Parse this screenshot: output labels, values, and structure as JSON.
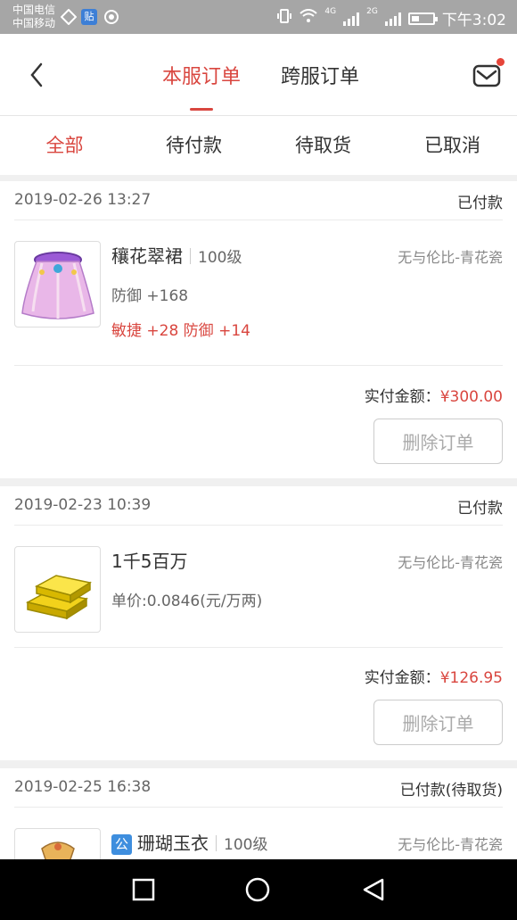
{
  "status_bar": {
    "carrier1": "中国电信",
    "carrier2": "中国移动",
    "tieba_badge": "贴",
    "net1": "4G",
    "net2": "2G",
    "time": "下午3:02"
  },
  "header": {
    "tabs": [
      {
        "label": "本服订单",
        "active": true
      },
      {
        "label": "跨服订单",
        "active": false
      }
    ],
    "accent": "#d9463f"
  },
  "filters": [
    {
      "label": "全部",
      "active": true
    },
    {
      "label": "待付款",
      "active": false
    },
    {
      "label": "待取货",
      "active": false
    },
    {
      "label": "已取消",
      "active": false
    }
  ],
  "orders": [
    {
      "date": "2019-02-26 13:27",
      "status": "已付款",
      "item_name": "穰花翠裙",
      "level": "100级",
      "server": "无与伦比-青花瓷",
      "attr1": "防御 +168",
      "attr2": "敏捷 +28 防御 +14",
      "paid_label": "实付金额：",
      "paid_amount": "¥300.00",
      "delete_label": "删除订单"
    },
    {
      "date": "2019-02-23 10:39",
      "status": "已付款",
      "item_name": "1千5百万",
      "server": "无与伦比-青花瓷",
      "unit_price": "单价:0.0846(元/万两)",
      "paid_label": "实付金额：",
      "paid_amount": "¥126.95",
      "delete_label": "删除订单"
    },
    {
      "date": "2019-02-25 16:38",
      "status": "已付款(待取货)",
      "badge": "公",
      "item_name": "珊瑚玉衣",
      "level": "100级",
      "server": "无与伦比-青花瓷"
    }
  ]
}
